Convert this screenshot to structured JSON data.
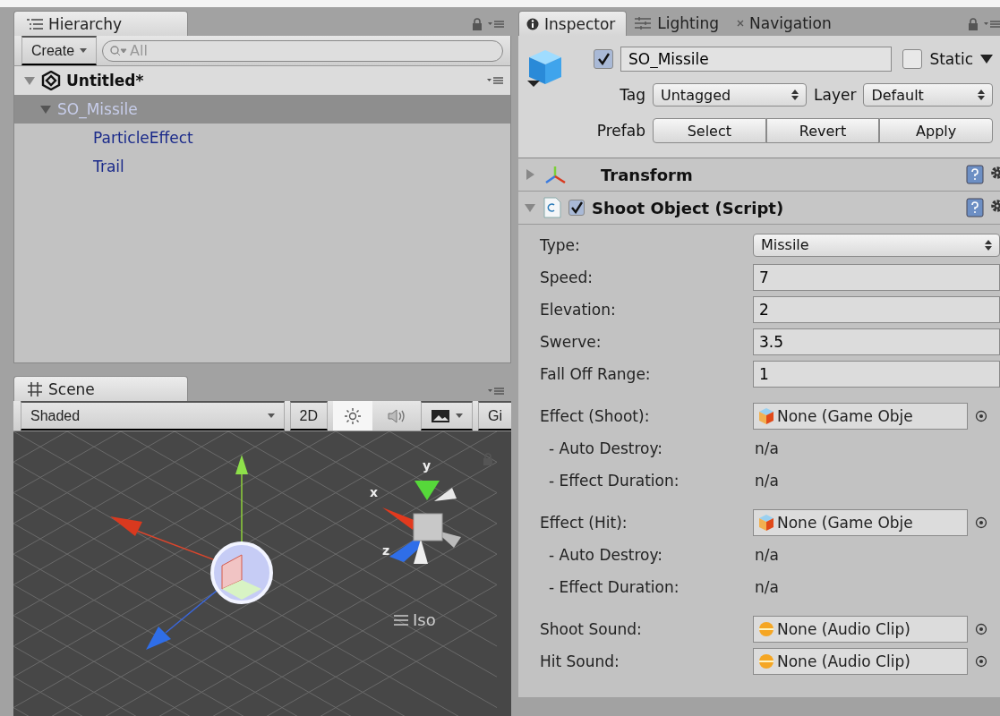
{
  "hierarchy": {
    "tab": "Hierarchy",
    "create": "Create",
    "search": {
      "placeholder": "All"
    },
    "scene": {
      "name": "Untitled*",
      "expanded": true
    },
    "items": [
      {
        "name": "SO_Missile",
        "selected": true,
        "expanded": true,
        "children": [
          {
            "name": "ParticleEffect",
            "selected": false
          },
          {
            "name": "Trail",
            "selected": false
          }
        ]
      }
    ]
  },
  "scene_view": {
    "tab": "Scene",
    "shading": "Shaded",
    "mode_2d": {
      "label": "2D",
      "on": false
    },
    "lighting_on": true,
    "gizmos": "Gi",
    "axis_labels": {
      "x": "x",
      "y": "y",
      "z": "z"
    },
    "projection": "Iso"
  },
  "inspector": {
    "tabs": [
      {
        "label": "Inspector",
        "selected": true
      },
      {
        "label": "Lighting",
        "selected": false
      },
      {
        "label": "Navigation",
        "selected": false
      }
    ],
    "object": {
      "active": true,
      "name": "SO_Missile",
      "static": false,
      "static_label": "Static",
      "tag_label": "Tag",
      "tag": "Untagged",
      "layer_label": "Layer",
      "layer": "Default",
      "prefab_label": "Prefab",
      "prefab_buttons": [
        "Select",
        "Revert",
        "Apply"
      ]
    },
    "components": [
      {
        "kind": "transform",
        "name": "Transform",
        "expanded": false
      },
      {
        "kind": "script",
        "name": "Shoot Object (Script)",
        "expanded": true,
        "enabled": true,
        "groups": [
          {
            "fields": [
              {
                "kind": "dropdown",
                "label": "Type:",
                "value": "Missile"
              },
              {
                "kind": "number",
                "label": "Speed:",
                "value": "7"
              },
              {
                "kind": "number",
                "label": "Elevation:",
                "value": "2"
              },
              {
                "kind": "number",
                "label": "Swerve:",
                "value": "3.5"
              },
              {
                "kind": "number",
                "label": "Fall Off Range:",
                "value": "1"
              }
            ]
          },
          {
            "fields": [
              {
                "kind": "gameobject",
                "label": "Effect (Shoot):",
                "value": "None (Game Obje"
              },
              {
                "kind": "info",
                "label": "- Auto Destroy:",
                "value": "n/a"
              },
              {
                "kind": "info",
                "label": "- Effect Duration:",
                "value": "n/a"
              }
            ]
          },
          {
            "fields": [
              {
                "kind": "gameobject",
                "label": "Effect (Hit):",
                "value": "None (Game Obje"
              },
              {
                "kind": "info",
                "label": "- Auto Destroy:",
                "value": "n/a"
              },
              {
                "kind": "info",
                "label": "- Effect Duration:",
                "value": "n/a"
              }
            ]
          },
          {
            "fields": [
              {
                "kind": "audioclip",
                "label": "Shoot Sound:",
                "value": "None (Audio Clip)"
              },
              {
                "kind": "audioclip",
                "label": "Hit Sound:",
                "value": "None (Audio Clip)"
              }
            ]
          }
        ]
      }
    ]
  }
}
